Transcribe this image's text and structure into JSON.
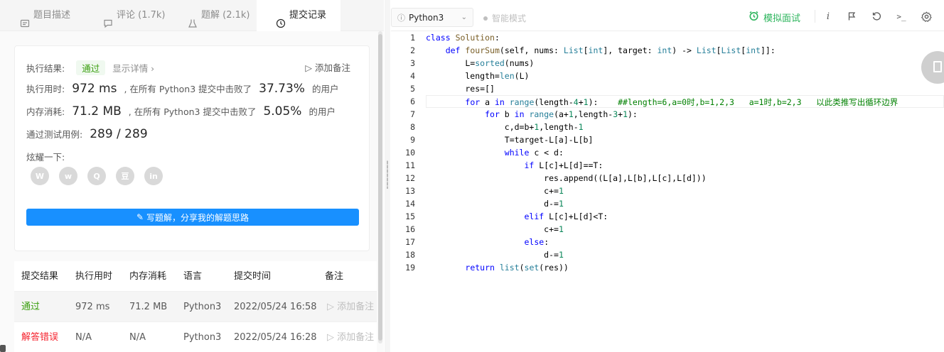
{
  "tabs": [
    {
      "label": "题目描述",
      "icon": "description-icon"
    },
    {
      "label": "评论 (1.7k)",
      "icon": "comment-icon"
    },
    {
      "label": "题解 (2.1k)",
      "icon": "flask-icon"
    },
    {
      "label": "提交记录",
      "icon": "clock-icon"
    }
  ],
  "result": {
    "exec_result_label": "执行结果:",
    "status": "通过",
    "details_link": "显示详情 ›",
    "add_note": "添加备注",
    "time_label": "执行用时:",
    "time_value": "972 ms",
    "time_text": ", 在所有 Python3 提交中击败了",
    "time_percent": "37.73%",
    "time_suffix": "的用户",
    "mem_label": "内存消耗:",
    "mem_value": "71.2 MB",
    "mem_text": ", 在所有 Python3 提交中击败了",
    "mem_percent": "5.05%",
    "mem_suffix": "的用户",
    "tests_label": "通过测试用例:",
    "tests_value": "289 / 289",
    "share_label": "炫耀一下:",
    "share_icons": [
      {
        "icon": "wechat-icon",
        "glyph": "W"
      },
      {
        "icon": "weibo-icon",
        "glyph": "w"
      },
      {
        "icon": "qq-icon",
        "glyph": "Q"
      },
      {
        "icon": "douban-icon",
        "glyph": "豆"
      },
      {
        "icon": "linkedin-icon",
        "glyph": "in"
      }
    ],
    "write_button": "写题解，分享我的解题思路"
  },
  "table": {
    "headers": [
      "提交结果",
      "执行用时",
      "内存消耗",
      "语言",
      "提交时间",
      "备注"
    ],
    "rows": [
      {
        "status": "通过",
        "time": "972 ms",
        "memory": "71.2 MB",
        "lang": "Python3",
        "submitted": "2022/05/24 16:58",
        "note": "添加备注"
      },
      {
        "status": "解答错误",
        "time": "N/A",
        "memory": "N/A",
        "lang": "Python3",
        "submitted": "2022/05/24 16:28",
        "note": "添加备注"
      }
    ]
  },
  "toolbar": {
    "language": "Python3",
    "smart_mode": "智能模式",
    "mock_interview": "模拟面试"
  },
  "code": {
    "line_numbers": [
      "1",
      "2",
      "3",
      "4",
      "5",
      "6",
      "7",
      "8",
      "9",
      "10",
      "11",
      "12",
      "13",
      "14",
      "15",
      "16",
      "17",
      "18",
      "19"
    ],
    "lines": [
      "class Solution:",
      "    def fourSum(self, nums: List[int], target: int) -> List[List[int]]:",
      "        L=sorted(nums)",
      "        length=len(L)",
      "        res=[]",
      "        for a in range(length-4+1):    ##length=6,a=0时,b=1,2,3   a=1时,b=2,3   以此类推写出循环边界",
      "            for b in range(a+1,length-3+1):",
      "                c,d=b+1,length-1",
      "                T=target-L[a]-L[b]",
      "                while c < d:",
      "                    if L[c]+L[d]==T:",
      "                        res.append((L[a],L[b],L[c],L[d]))",
      "                        c+=1",
      "                        d-=1",
      "                    elif L[c]+L[d]<T:",
      "                        c+=1",
      "                    else:",
      "                        d-=1",
      "        return list(set(res))"
    ]
  }
}
